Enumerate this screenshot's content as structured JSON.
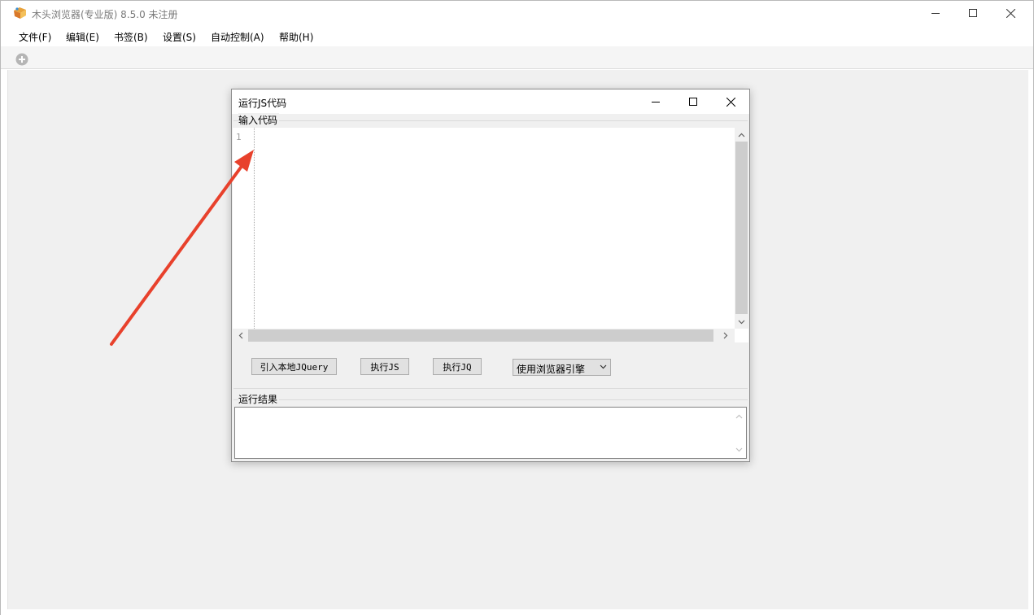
{
  "window": {
    "title": "木头浏览器(专业版) 8.5.0  未注册",
    "minimize_icon": "minimize-icon",
    "maximize_icon": "maximize-icon",
    "close_icon": "close-icon"
  },
  "menu": {
    "items": [
      {
        "label": "文件(F)"
      },
      {
        "label": "编辑(E)"
      },
      {
        "label": "书签(B)"
      },
      {
        "label": "设置(S)"
      },
      {
        "label": "自动控制(A)"
      },
      {
        "label": "帮助(H)"
      }
    ]
  },
  "toolbar": {
    "new_tab_icon": "plus-circle-icon"
  },
  "dialog": {
    "title": "运行JS代码",
    "input_group_label": "输入代码",
    "line_numbers": [
      "1"
    ],
    "code_value": "",
    "buttons": {
      "import_jquery": "引入本地JQuery",
      "run_js": "执行JS",
      "run_jq": "执行JQ"
    },
    "engine_select": {
      "selected": "使用浏览器引擎"
    },
    "result_group_label": "运行结果",
    "result_value": ""
  },
  "annotation": {
    "color": "#e8412c"
  }
}
